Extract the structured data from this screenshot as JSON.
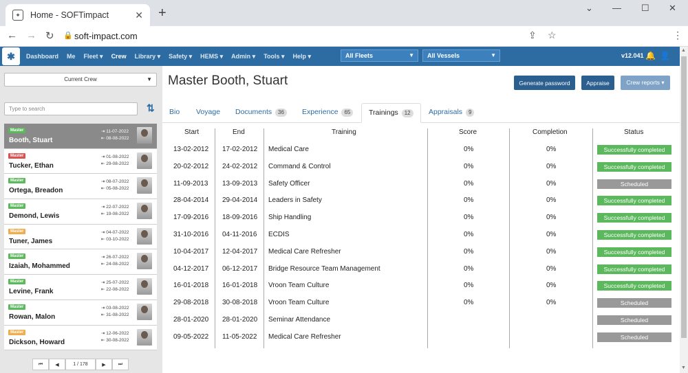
{
  "browser": {
    "tab_title": "Home - SOFTimpact",
    "url": "soft-impact.com"
  },
  "nav": {
    "items": [
      {
        "label": "Dashboard"
      },
      {
        "label": "Me"
      },
      {
        "label": "Fleet ▾"
      },
      {
        "label": "Crew",
        "active": true
      },
      {
        "label": "Library ▾"
      },
      {
        "label": "Safety ▾"
      },
      {
        "label": "HEMS ▾"
      },
      {
        "label": "Admin ▾"
      },
      {
        "label": "Tools ▾"
      },
      {
        "label": "Help ▾"
      }
    ],
    "fleets_select": "All Fleets",
    "vessels_select": "All Vessels",
    "version": "v12.041"
  },
  "sidebar": {
    "crew_filter": "Current Crew",
    "search_placeholder": "Type to search",
    "crew": [
      {
        "rank": "Master",
        "rank_color": "#5cb85c",
        "name": "Booth, Stuart",
        "date_on": "11-07-2022",
        "date_off": "08-08-2022",
        "selected": true
      },
      {
        "rank": "Master",
        "rank_color": "#d9534f",
        "name": "Tucker, Ethan",
        "date_on": "01-08-2022",
        "date_off": "29-08-2022"
      },
      {
        "rank": "Master",
        "rank_color": "#5cb85c",
        "name": "Ortega, Breadon",
        "date_on": "08-07-2022",
        "date_off": "05-08-2022"
      },
      {
        "rank": "Master",
        "rank_color": "#5cb85c",
        "name": "Demond, Lewis",
        "date_on": "22-07-2022",
        "date_off": "19-08-2022"
      },
      {
        "rank": "Master",
        "rank_color": "#f0ad4e",
        "name": "Tuner, James",
        "date_on": "04-07-2022",
        "date_off": "03-10-2022"
      },
      {
        "rank": "Master",
        "rank_color": "#5cb85c",
        "name": "Izaiah, Mohammed",
        "date_on": "26-07-2022",
        "date_off": "24-08-2022"
      },
      {
        "rank": "Master",
        "rank_color": "#5cb85c",
        "name": "Levine, Frank",
        "date_on": "25-07-2022",
        "date_off": "22-08-2022"
      },
      {
        "rank": "Master",
        "rank_color": "#5cb85c",
        "name": "Rowan, Malon",
        "date_on": "03-08-2022",
        "date_off": "31-08-2022"
      },
      {
        "rank": "Master",
        "rank_color": "#f0ad4e",
        "name": "Dickson, Howard",
        "date_on": "12-06-2022",
        "date_off": "30-08-2022"
      }
    ],
    "pager": {
      "first": "⏮",
      "prev": "◀",
      "page": "1 / 178",
      "next": "▶",
      "last": "⏭"
    }
  },
  "main": {
    "title": "Master Booth, Stuart",
    "buttons": {
      "generate_password": "Generate password",
      "appraise": "Appraise",
      "crew_reports": "Crew reports ▾"
    },
    "tabs": [
      {
        "label": "Bio",
        "count": ""
      },
      {
        "label": "Voyage",
        "count": ""
      },
      {
        "label": "Documents",
        "count": "36"
      },
      {
        "label": "Experience",
        "count": "65"
      },
      {
        "label": "Trainings",
        "count": "12",
        "active": true
      },
      {
        "label": "Appraisals",
        "count": "9"
      }
    ],
    "table": {
      "headers": {
        "start": "Start",
        "end": "End",
        "training": "Training",
        "score": "Score",
        "completion": "Completion",
        "status": "Status"
      },
      "rows": [
        {
          "start": "13-02-2012",
          "end": "17-02-2012",
          "training": "Medical Care",
          "score": "0%",
          "completion": "0%",
          "status": "Successfully completed"
        },
        {
          "start": "20-02-2012",
          "end": "24-02-2012",
          "training": "Command & Control",
          "score": "0%",
          "completion": "0%",
          "status": "Successfully completed"
        },
        {
          "start": "11-09-2013",
          "end": "13-09-2013",
          "training": "Safety Officer",
          "score": "0%",
          "completion": "0%",
          "status": "Scheduled"
        },
        {
          "start": "28-04-2014",
          "end": "29-04-2014",
          "training": "Leaders in Safety",
          "score": "0%",
          "completion": "0%",
          "status": "Successfully completed"
        },
        {
          "start": "17-09-2016",
          "end": "18-09-2016",
          "training": "Ship Handling",
          "score": "0%",
          "completion": "0%",
          "status": "Successfully completed"
        },
        {
          "start": "31-10-2016",
          "end": "04-11-2016",
          "training": "ECDIS",
          "score": "0%",
          "completion": "0%",
          "status": "Successfully completed"
        },
        {
          "start": "10-04-2017",
          "end": "12-04-2017",
          "training": "Medical Care Refresher",
          "score": "0%",
          "completion": "0%",
          "status": "Successfully completed"
        },
        {
          "start": "04-12-2017",
          "end": "06-12-2017",
          "training": "Bridge Resource Team Management",
          "score": "0%",
          "completion": "0%",
          "status": "Successfully completed"
        },
        {
          "start": "16-01-2018",
          "end": "16-01-2018",
          "training": "Vroon Team Culture",
          "score": "0%",
          "completion": "0%",
          "status": "Successfully completed"
        },
        {
          "start": "29-08-2018",
          "end": "30-08-2018",
          "training": "Vroon Team Culture",
          "score": "0%",
          "completion": "0%",
          "status": "Scheduled"
        },
        {
          "start": "28-01-2020",
          "end": "28-01-2020",
          "training": "Seminar Attendance",
          "score": "",
          "completion": "",
          "status": "Scheduled"
        },
        {
          "start": "09-05-2022",
          "end": "11-05-2022",
          "training": "Medical Care Refresher",
          "score": "",
          "completion": "",
          "status": "Scheduled"
        }
      ]
    },
    "status_colors": {
      "Successfully completed": "#5cb85c",
      "Scheduled": "#999999"
    }
  }
}
